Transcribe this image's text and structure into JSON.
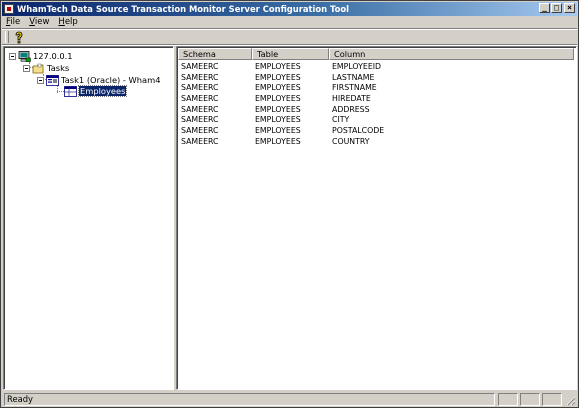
{
  "window": {
    "title": "WhamTech Data Source Transaction Monitor Server Configuration Tool",
    "caption_minimize": "_",
    "caption_maximize": "□",
    "caption_close": "×"
  },
  "menu": {
    "file": {
      "key": "F",
      "rest": "ile"
    },
    "view": {
      "key": "V",
      "rest": "iew"
    },
    "help": {
      "key": "H",
      "rest": "elp"
    }
  },
  "toolbar": {
    "help_icon": "help-question-icon"
  },
  "tree": {
    "root": "127.0.0.1",
    "tasks": "Tasks",
    "task1": "Task1 (Oracle) - Wham4",
    "employees": "Employees"
  },
  "list": {
    "columns": [
      "Schema",
      "Table",
      "Column"
    ],
    "rows": [
      [
        "SAMEERC",
        "EMPLOYEES",
        "EMPLOYEEID"
      ],
      [
        "SAMEERC",
        "EMPLOYEES",
        "LASTNAME"
      ],
      [
        "SAMEERC",
        "EMPLOYEES",
        "FIRSTNAME"
      ],
      [
        "SAMEERC",
        "EMPLOYEES",
        "HIREDATE"
      ],
      [
        "SAMEERC",
        "EMPLOYEES",
        "ADDRESS"
      ],
      [
        "SAMEERC",
        "EMPLOYEES",
        "CITY"
      ],
      [
        "SAMEERC",
        "EMPLOYEES",
        "POSTALCODE"
      ],
      [
        "SAMEERC",
        "EMPLOYEES",
        "COUNTRY"
      ]
    ]
  },
  "status": {
    "text": "Ready"
  },
  "colors": {
    "title_start": "#0a246a",
    "title_end": "#a6caf0",
    "face": "#d4d0c8",
    "selection": "#0a246a"
  }
}
